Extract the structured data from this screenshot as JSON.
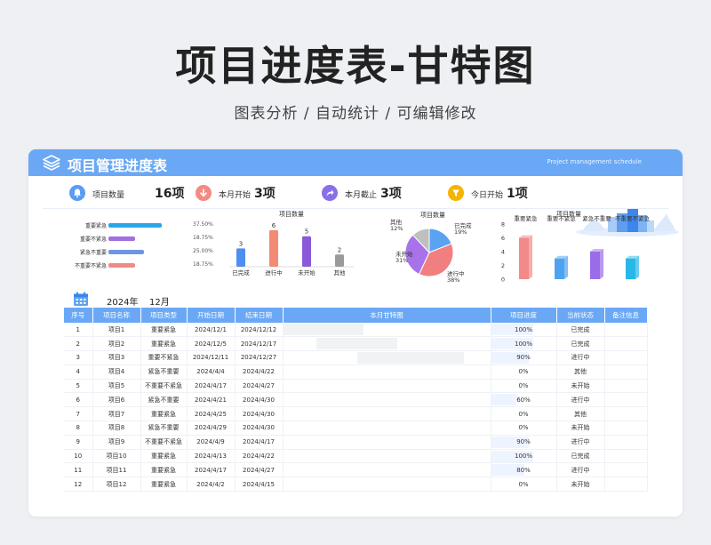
{
  "hero": {
    "title": "项目进度表-甘特图",
    "subtitle": "图表分析 / 自动统计 / 可编辑修改"
  },
  "header": {
    "title": "项目管理进度表",
    "subtitle_en": "Project management schedule"
  },
  "stats": [
    {
      "label": "项目数量",
      "value": "16项",
      "color": "#5b9cf2",
      "icon": "bell-icon"
    },
    {
      "label": "本月开始",
      "value": "3项",
      "color": "#f28b82",
      "icon": "arrow-down-icon"
    },
    {
      "label": "本月截止",
      "value": "3项",
      "color": "#8b6fe8",
      "icon": "share-arrow-icon"
    },
    {
      "label": "今日开始",
      "value": "1项",
      "color": "#f5b400",
      "icon": "filter-icon"
    }
  ],
  "charts": [
    {
      "type": "bar",
      "orientation": "horizontal",
      "categories": [
        "重要紧急",
        "重要不紧急",
        "紧急不重要",
        "不重要不紧急"
      ],
      "values": [
        37.5,
        18.75,
        25.0,
        18.75
      ],
      "labels": [
        "37.50%",
        "18.75%",
        "25.00%",
        "18.75%"
      ],
      "colors": [
        "#2aa6e6",
        "#a06fe0",
        "#6c95e6",
        "#f08a8a"
      ],
      "xlim": [
        0,
        50
      ]
    },
    {
      "type": "bar",
      "title": "项目数量",
      "categories": [
        "已完成",
        "进行中",
        "未开始",
        "其他"
      ],
      "values": [
        3,
        6,
        5,
        2
      ],
      "colors": [
        "#4d8ff0",
        "#f28a74",
        "#8a5ad8",
        "#9a9a9a"
      ],
      "ylim": [
        0,
        7
      ]
    },
    {
      "type": "pie",
      "title": "项目数量",
      "labels": [
        "已完成",
        "进行中",
        "未开始",
        "其他"
      ],
      "values": [
        19,
        38,
        31,
        12
      ],
      "pct_labels": [
        "19%",
        "38%",
        "31%",
        "12%"
      ],
      "colors": [
        "#5aa2f2",
        "#f27f7f",
        "#a873ea",
        "#bfbfbf"
      ]
    },
    {
      "type": "bar",
      "title": "项目数量",
      "categories": [
        "重要紧急",
        "重要不紧急",
        "紧急不重要",
        "不重要不紧急"
      ],
      "values": [
        6,
        3,
        4,
        3
      ],
      "yticks": [
        "0",
        "2",
        "4",
        "6",
        "8"
      ],
      "colors": [
        "#f28a8a",
        "#4da3f0",
        "#9a6ce8",
        "#27b8e8"
      ],
      "ylim": [
        0,
        8
      ]
    }
  ],
  "table": {
    "year": "2024年",
    "month": "12月",
    "columns": [
      "序号",
      "项目名称",
      "项目类型",
      "开始日期",
      "结束日期",
      "本月甘特图",
      "项目进度",
      "当前状态",
      "备注信息"
    ],
    "rows": [
      {
        "no": "1",
        "name": "项目1",
        "type": "重要紧急",
        "start": "2024/12/1",
        "end": "2024/12/12",
        "progress": "100%",
        "pct": 100,
        "status": "已完成",
        "g0": 0,
        "g1": 12
      },
      {
        "no": "2",
        "name": "项目2",
        "type": "重要紧急",
        "start": "2024/12/5",
        "end": "2024/12/17",
        "progress": "100%",
        "pct": 100,
        "status": "已完成",
        "g0": 5,
        "g1": 17
      },
      {
        "no": "3",
        "name": "项目3",
        "type": "重要不紧急",
        "start": "2024/12/11",
        "end": "2024/12/27",
        "progress": "90%",
        "pct": 90,
        "status": "进行中",
        "g0": 11,
        "g1": 27
      },
      {
        "no": "4",
        "name": "项目4",
        "type": "紧急不重要",
        "start": "2024/4/4",
        "end": "2024/4/22",
        "progress": "0%",
        "pct": 0,
        "status": "其他",
        "g0": 0,
        "g1": 0
      },
      {
        "no": "5",
        "name": "项目5",
        "type": "不重要不紧急",
        "start": "2024/4/17",
        "end": "2024/4/27",
        "progress": "0%",
        "pct": 0,
        "status": "未开始",
        "g0": 0,
        "g1": 0
      },
      {
        "no": "6",
        "name": "项目6",
        "type": "紧急不重要",
        "start": "2024/4/21",
        "end": "2024/4/30",
        "progress": "60%",
        "pct": 60,
        "status": "进行中",
        "g0": 0,
        "g1": 0
      },
      {
        "no": "7",
        "name": "项目7",
        "type": "重要紧急",
        "start": "2024/4/25",
        "end": "2024/4/30",
        "progress": "0%",
        "pct": 0,
        "status": "其他",
        "g0": 0,
        "g1": 0
      },
      {
        "no": "8",
        "name": "项目8",
        "type": "紧急不重要",
        "start": "2024/4/29",
        "end": "2024/4/30",
        "progress": "0%",
        "pct": 0,
        "status": "未开始",
        "g0": 0,
        "g1": 0
      },
      {
        "no": "9",
        "name": "项目9",
        "type": "不重要不紧急",
        "start": "2024/4/9",
        "end": "2024/4/17",
        "progress": "90%",
        "pct": 90,
        "status": "进行中",
        "g0": 0,
        "g1": 0
      },
      {
        "no": "10",
        "name": "项目10",
        "type": "重要紧急",
        "start": "2024/4/13",
        "end": "2024/4/22",
        "progress": "100%",
        "pct": 100,
        "status": "已完成",
        "g0": 0,
        "g1": 0
      },
      {
        "no": "11",
        "name": "项目11",
        "type": "重要紧急",
        "start": "2024/4/17",
        "end": "2024/4/27",
        "progress": "80%",
        "pct": 80,
        "status": "进行中",
        "g0": 0,
        "g1": 0
      },
      {
        "no": "12",
        "name": "项目12",
        "type": "重要紧急",
        "start": "2024/4/2",
        "end": "2024/4/15",
        "progress": "0%",
        "pct": 0,
        "status": "未开始",
        "g0": 0,
        "g1": 0
      }
    ]
  }
}
